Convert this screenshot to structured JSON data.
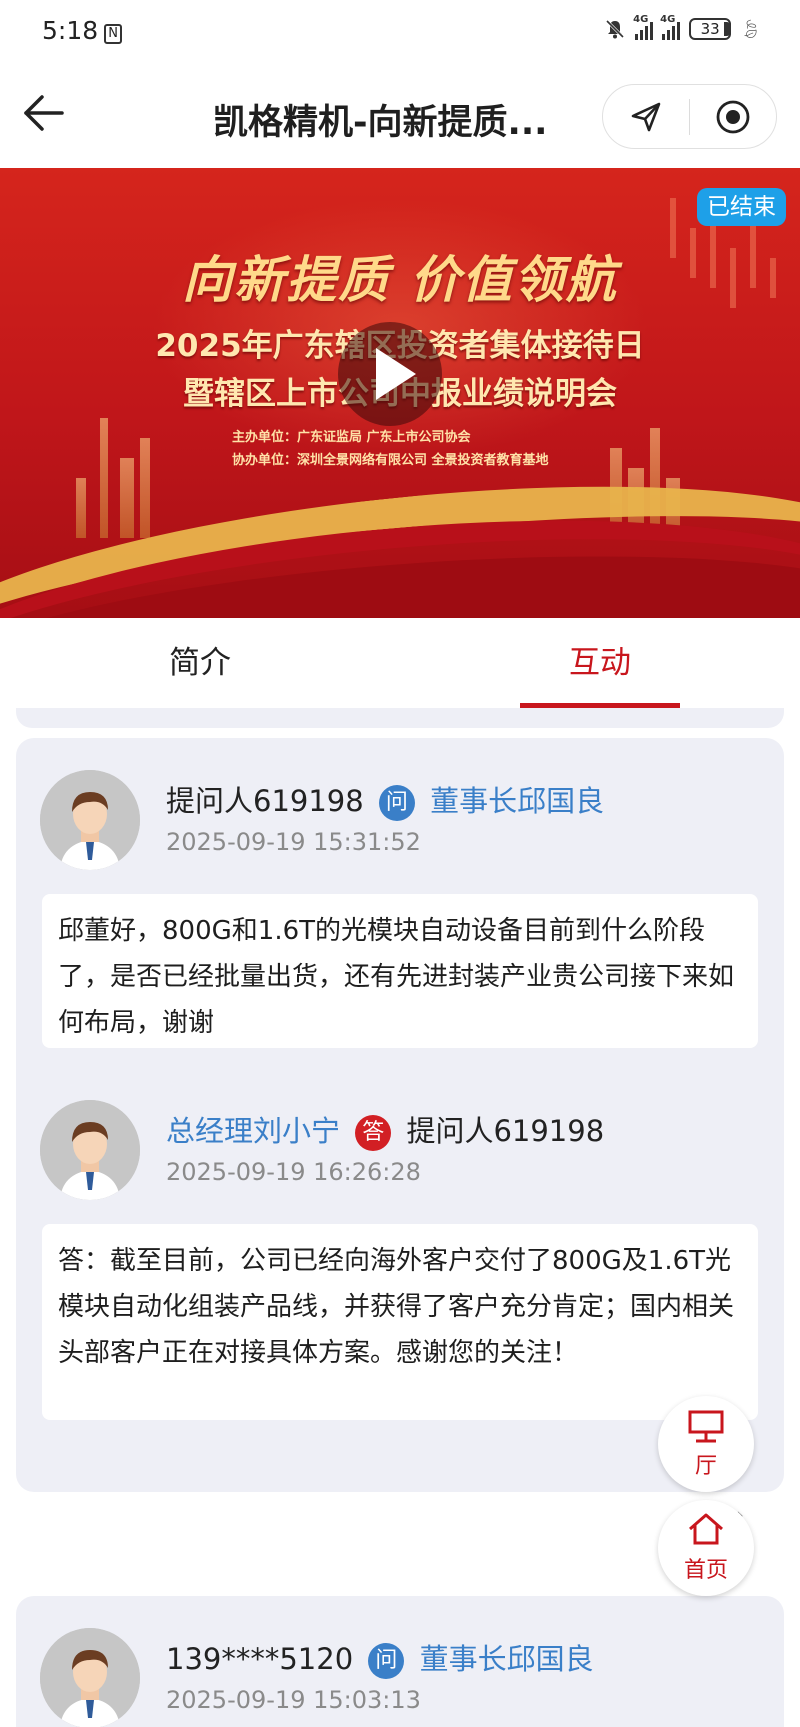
{
  "status_bar": {
    "time": "5:18",
    "nfc": "N",
    "net1": "4G",
    "net2": "4G",
    "battery": "33"
  },
  "header": {
    "title": "凯格精机-向新提质..."
  },
  "banner": {
    "status": "已结束",
    "slogan": "向新提质 价值领航",
    "line1": "2025年广东辖区投资者集体接待日",
    "line2": "暨辖区上市公司中报业绩说明会",
    "organizer": "主办单位：广东证监局  广东上市公司协会",
    "co_organizer": "协办单位：深圳全景网络有限公司  全景投资者教育基地"
  },
  "tabs": [
    {
      "label": "简介",
      "active": false
    },
    {
      "label": "互动",
      "active": true
    }
  ],
  "colors": {
    "accent": "#c8161d",
    "link": "#3a7fc8",
    "card_bg": "#eeeff6",
    "chip": "#1ea0e8"
  },
  "qa": [
    {
      "question": {
        "asker": "提问人619198",
        "badge": "问",
        "target": "董事长邱国良",
        "time": "2025-09-19 15:31:52",
        "text": "邱董好，800G和1.6T的光模块自动设备目前到什么阶段了，是否已经批量出货，还有先进封装产业贵公司接下来如何布局，谢谢"
      },
      "answer": {
        "responder": "总经理刘小宁",
        "badge": "答",
        "target": "提问人619198",
        "time": "2025-09-19 16:26:28",
        "text": "答：截至目前，公司已经向海外客户交付了800G及1.6T光模块自动化组装产品线，并获得了客户充分肯定；国内相关头部客户正在对接具体方案。感谢您的关注！"
      }
    },
    {
      "question": {
        "asker": "139****5120",
        "badge": "问",
        "target": "董事长邱国良",
        "time": "2025-09-19 15:03:13"
      }
    }
  ],
  "floating": {
    "hall_label": "厅",
    "home_label": "首页"
  }
}
